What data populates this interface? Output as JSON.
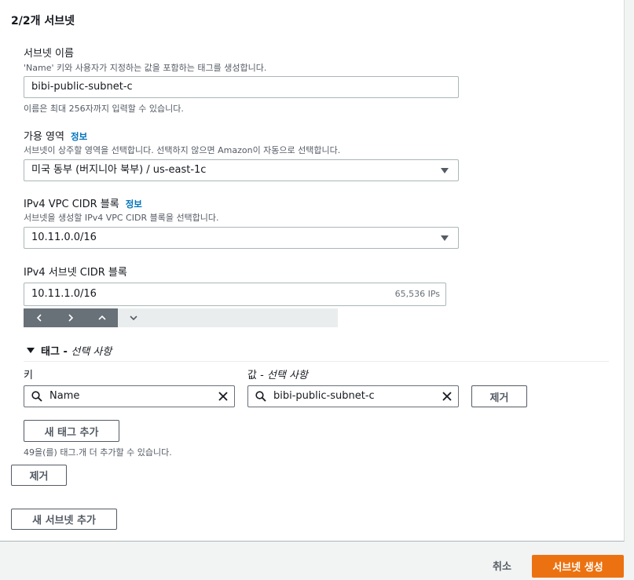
{
  "section": {
    "title": "2/2개 서브넷"
  },
  "subnet_name": {
    "label": "서브넷 이름",
    "description": "'Name' 키와 사용자가 지정하는 값을 포함하는 태그를 생성합니다.",
    "value": "bibi-public-subnet-c",
    "hint": "이름은 최대 256자까지 입력할 수 있습니다."
  },
  "availability_zone": {
    "label": "가용 영역",
    "info": "정보",
    "description": "서브넷이 상주할 영역을 선택합니다. 선택하지 않으면 Amazon이 자동으로 선택합니다.",
    "value": "미국 동부 (버지니아 북부) / us-east-1c"
  },
  "vpc_cidr": {
    "label": "IPv4 VPC CIDR 블록",
    "info": "정보",
    "description": "서브넷을 생성할 IPv4 VPC CIDR 블록을 선택합니다.",
    "value": "10.11.0.0/16"
  },
  "subnet_cidr": {
    "label": "IPv4 서브넷 CIDR 블록",
    "value": "10.11.1.0/16",
    "ip_count": "65,536 IPs"
  },
  "tags": {
    "header_prefix": "태그 - ",
    "header_optional": "선택 사항",
    "key_label": "키",
    "value_label_prefix": "값 - ",
    "value_label_optional": "선택 사항",
    "key_value": "Name",
    "value_value": "bibi-public-subnet-c",
    "remove_tag_label": "제거",
    "add_tag_label": "새 태그 추가",
    "remaining_hint": "49을(를) 태그.개 더 추가할 수 있습니다."
  },
  "actions": {
    "remove_subnet_label": "제거",
    "add_subnet_label": "새 서브넷 추가",
    "cancel_label": "취소",
    "create_label": "서브넷 생성"
  },
  "colors": {
    "primary": "#ec7211",
    "link": "#0073bb",
    "stepper": "#687078"
  }
}
